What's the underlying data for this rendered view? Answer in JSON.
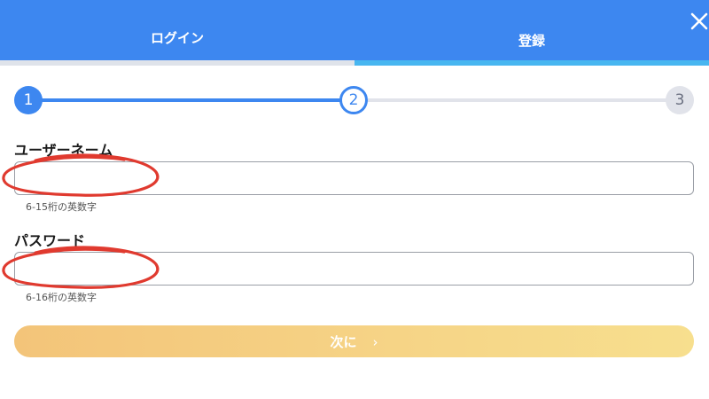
{
  "tabs": [
    {
      "label": "ログイン",
      "active": false
    },
    {
      "label": "登録",
      "active": true
    }
  ],
  "close_icon": "close-icon",
  "stepper": {
    "steps": [
      "1",
      "2",
      "3"
    ],
    "current_step": 2,
    "colors": {
      "done": "#3d87f0",
      "todo": "#e1e3ea"
    }
  },
  "form": {
    "username": {
      "label": "ユーザーネーム",
      "value": "",
      "placeholder": "",
      "hint": "6-15桁の英数字"
    },
    "password": {
      "label": "パスワード",
      "value": "",
      "placeholder": "",
      "hint": "6-16桁の英数字"
    }
  },
  "next_button": {
    "label": "次に",
    "icon": "chevron-right-icon"
  },
  "colors": {
    "header": "#3d87f0",
    "active_tab_underline": "#48b6f0",
    "annotation": "#e03a2f",
    "button_gradient_start": "#f3c479",
    "button_gradient_end": "#f7df8e"
  }
}
